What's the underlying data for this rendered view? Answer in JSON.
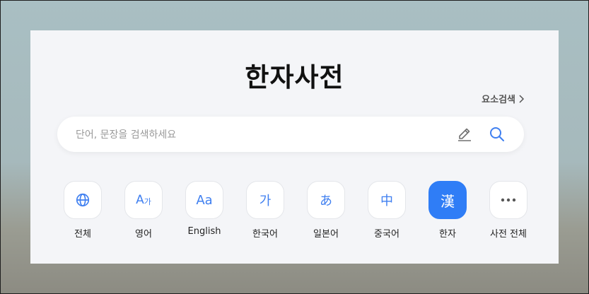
{
  "title": "한자사전",
  "element_search": {
    "label": "요소검색"
  },
  "search": {
    "placeholder": "단어, 문장을 검색하세요",
    "value": ""
  },
  "accent_color": "#2f7df6",
  "categories": [
    {
      "label": "전체",
      "glyph": "",
      "icon": "globe-icon"
    },
    {
      "label": "영어",
      "glyph": "A가",
      "icon": "english-korean-icon"
    },
    {
      "label": "English",
      "glyph": "Aa",
      "icon": "english-icon"
    },
    {
      "label": "한국어",
      "glyph": "가",
      "icon": "korean-icon"
    },
    {
      "label": "일본어",
      "glyph": "あ",
      "icon": "japanese-icon"
    },
    {
      "label": "중국어",
      "glyph": "中",
      "icon": "chinese-icon"
    },
    {
      "label": "한자",
      "glyph": "漢",
      "icon": "hanja-icon",
      "active": true
    },
    {
      "label": "사전 전체",
      "glyph": "",
      "icon": "more-icon"
    }
  ]
}
